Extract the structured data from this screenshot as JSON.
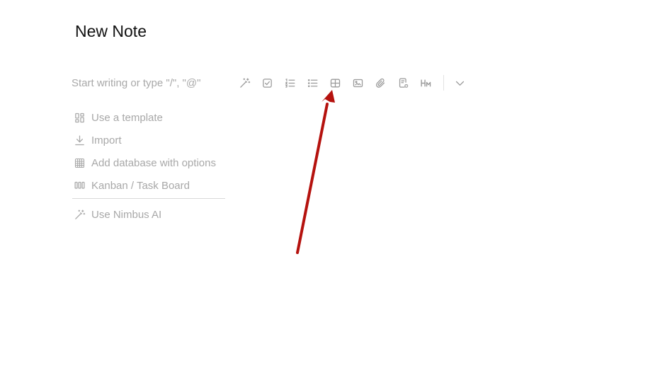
{
  "note": {
    "title": "New Note",
    "placeholder": "Start writing or type \"/\", \"@\""
  },
  "toolbar": {
    "buttons": [
      {
        "name": "ai-magic-wand-icon"
      },
      {
        "name": "checkbox-icon"
      },
      {
        "name": "numbered-list-icon"
      },
      {
        "name": "bulleted-list-icon"
      },
      {
        "name": "table-icon"
      },
      {
        "name": "image-icon"
      },
      {
        "name": "attachment-icon"
      },
      {
        "name": "embed-document-icon"
      },
      {
        "name": "heading-icon"
      }
    ],
    "expand": {
      "name": "chevron-down-icon"
    }
  },
  "menu": {
    "items": [
      {
        "label": "Use a template",
        "icon": "template-icon"
      },
      {
        "label": "Import",
        "icon": "import-icon"
      },
      {
        "label": "Add database with options",
        "icon": "database-icon"
      },
      {
        "label": "Kanban / Task Board",
        "icon": "kanban-icon"
      }
    ],
    "ai_item": {
      "label": "Use Nimbus AI",
      "icon": "ai-magic-wand-icon"
    }
  },
  "annotation": {
    "arrow_color": "#b5120e"
  }
}
